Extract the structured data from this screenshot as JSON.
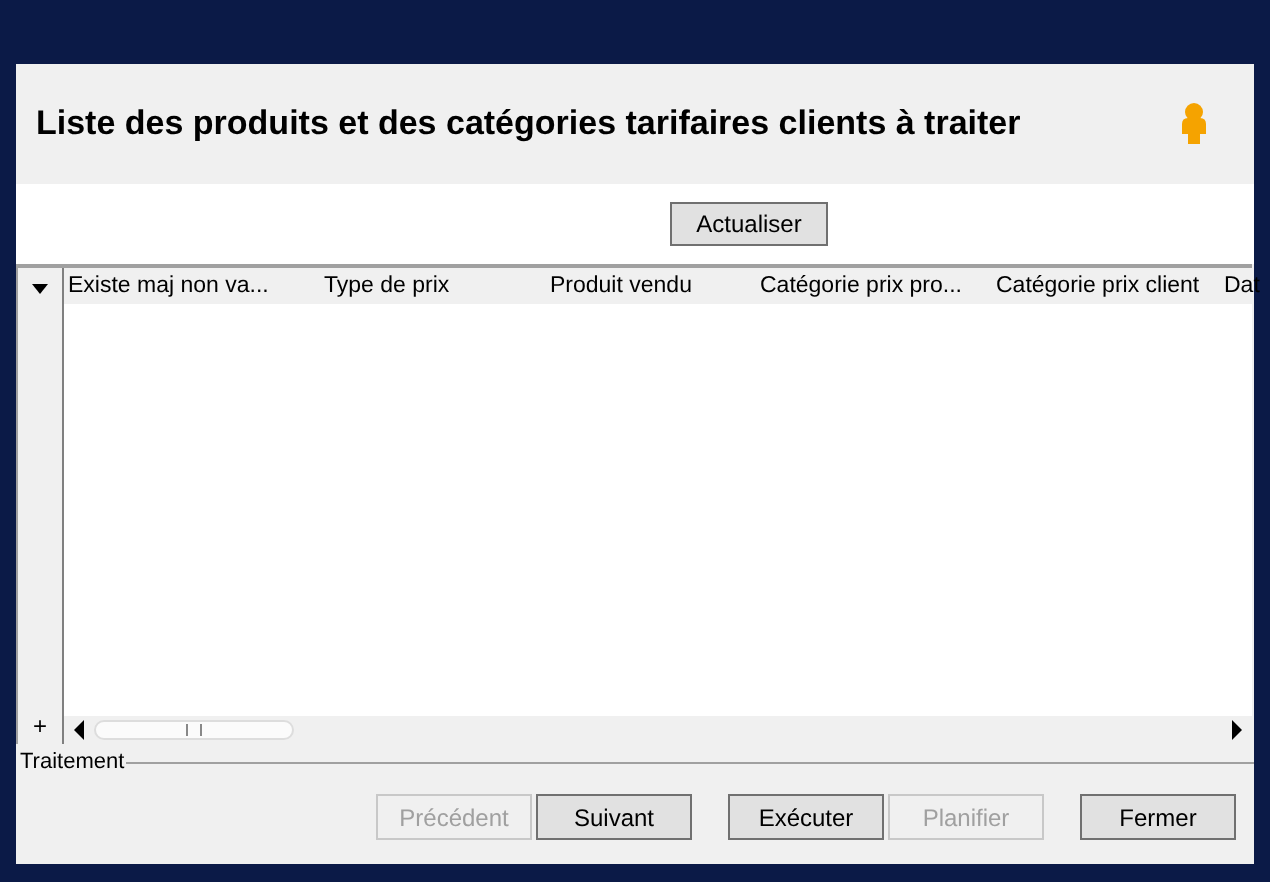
{
  "window": {
    "title": "Liste des produits et des catégories tarifaires clients à traiter"
  },
  "refresh_button": {
    "label": "Actualiser"
  },
  "table": {
    "columns": [
      {
        "label": "Existe maj non va..."
      },
      {
        "label": "Type de prix"
      },
      {
        "label": "Produit vendu"
      },
      {
        "label": "Catégorie prix pro..."
      },
      {
        "label": "Catégorie prix client"
      },
      {
        "label": "Dat"
      }
    ],
    "add_label": "+"
  },
  "section": {
    "label": "Traitement"
  },
  "button_groups": [
    [
      {
        "label": "Précédent",
        "disabled": true
      },
      {
        "label": "Suivant",
        "disabled": false
      }
    ],
    [
      {
        "label": "Exécuter",
        "disabled": false
      },
      {
        "label": "Planifier",
        "disabled": true
      }
    ],
    [
      {
        "label": "Fermer",
        "disabled": false
      }
    ]
  ]
}
